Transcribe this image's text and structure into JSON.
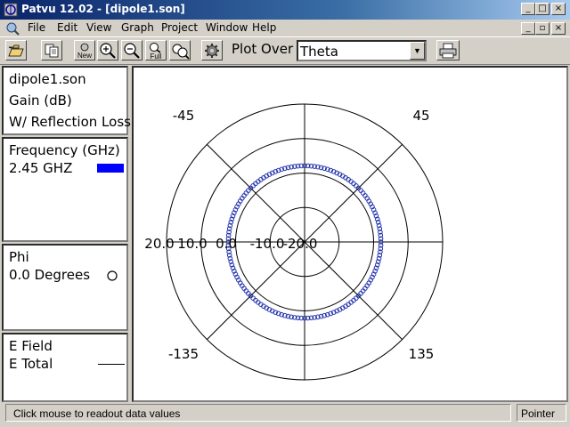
{
  "window": {
    "title": "Patvu 12.02 - [dipole1.son]",
    "controls": [
      "_",
      "□",
      "×"
    ]
  },
  "menubar": {
    "items": [
      {
        "label": "File",
        "accel": "F"
      },
      {
        "label": "Edit",
        "accel": "E"
      },
      {
        "label": "View",
        "accel": "V"
      },
      {
        "label": "Graph",
        "accel": "G"
      },
      {
        "label": "Project",
        "accel": "P"
      },
      {
        "label": "Window",
        "accel": "W"
      },
      {
        "label": "Help",
        "accel": "H"
      }
    ],
    "mdi_controls": [
      "_",
      "▫",
      "×"
    ]
  },
  "toolbar": {
    "tools": [
      "open-icon",
      "copy-icon",
      "new-icon",
      "zoom-in-icon",
      "zoom-out-icon",
      "full-icon",
      "zoom-region-icon",
      "settings-gear-icon",
      "print-icon"
    ],
    "new_label": "New",
    "full_label": "Full",
    "plot_over_label": "Plot Over",
    "plot_over_value": "Theta"
  },
  "info_panel": {
    "filename": "dipole1.son",
    "quantity": "Gain (dB)",
    "note": "W/ Reflection Loss"
  },
  "frequency_panel": {
    "header": "Frequency (GHz)",
    "value": "2.45 GHZ",
    "swatch_color": "#0000ff"
  },
  "phi_panel": {
    "header": "Phi",
    "value": "0.0 Degrees"
  },
  "field_panel": {
    "header": "E Field",
    "value": "E Total"
  },
  "polar_plot": {
    "angle_labels": [
      "-45",
      "45",
      "-135",
      "135"
    ],
    "radial_labels": [
      "20.0",
      "10.0",
      "0.0",
      "-10.0",
      "-20.0"
    ],
    "series_color": "#2233aa",
    "chart_data": {
      "type": "scatter",
      "r_axis_labels": [
        -20,
        -10,
        0,
        10,
        20
      ],
      "r_inner": -20,
      "r_outer": 20,
      "series_value_db": 2.1
    }
  },
  "statusbar": {
    "message": "Click mouse to readout data values",
    "mode": "Pointer"
  }
}
